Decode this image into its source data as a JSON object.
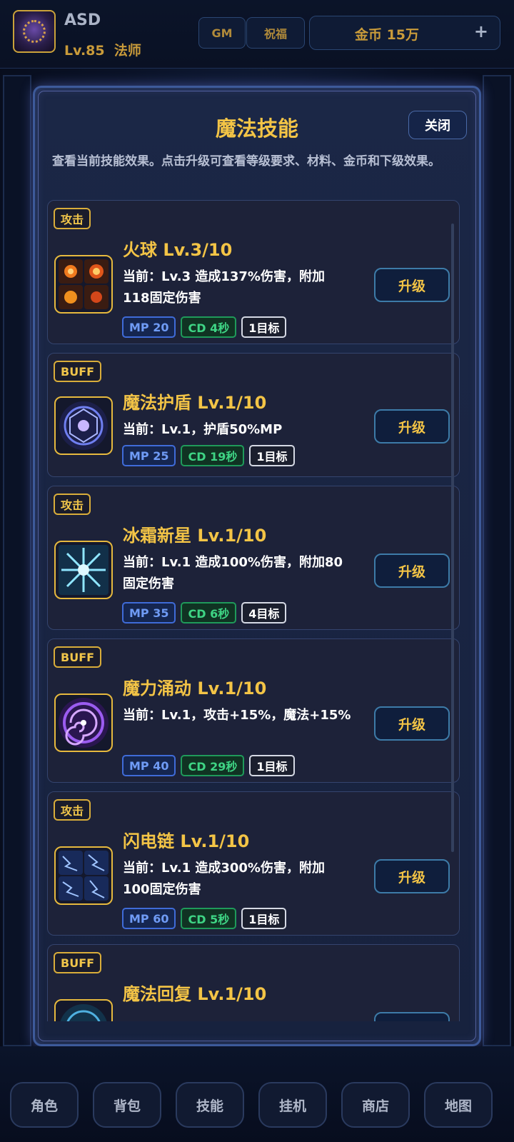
{
  "player": {
    "name": "ASD",
    "level": "Lv.85",
    "class": "法师"
  },
  "top_buttons": {
    "gm": "GM",
    "bless": "祝福",
    "gold": "金币 15万",
    "plus": "+"
  },
  "modal": {
    "title": "魔法技能",
    "close": "关闭",
    "description": "查看当前技能效果。点击升级可查看等级要求、材料、金币和下级效果。",
    "upgrade_label": "升级"
  },
  "skills": [
    {
      "tag": "攻击",
      "name": "火球  Lv.3/10",
      "desc": "当前：Lv.3 造成137%伤害，附加118固定伤害",
      "mp": "MP 20",
      "cd": "CD 4秒",
      "target": "1目标",
      "icon": "fireball-icon"
    },
    {
      "tag": "BUFF",
      "name": "魔法护盾  Lv.1/10",
      "desc": "当前：Lv.1，护盾50%MP",
      "mp": "MP 25",
      "cd": "CD 19秒",
      "target": "1目标",
      "icon": "magic-shield-icon"
    },
    {
      "tag": "攻击",
      "name": "冰霜新星  Lv.1/10",
      "desc": "当前：Lv.1 造成100%伤害，附加80固定伤害",
      "mp": "MP 35",
      "cd": "CD 6秒",
      "target": "4目标",
      "icon": "frost-nova-icon"
    },
    {
      "tag": "BUFF",
      "name": "魔力涌动  Lv.1/10",
      "desc": "当前：Lv.1，攻击+15%，魔法+15%",
      "mp": "MP 40",
      "cd": "CD 29秒",
      "target": "1目标",
      "icon": "mana-surge-icon"
    },
    {
      "tag": "攻击",
      "name": "闪电链  Lv.1/10",
      "desc": "当前：Lv.1 造成300%伤害，附加100固定伤害",
      "mp": "MP 60",
      "cd": "CD 5秒",
      "target": "1目标",
      "icon": "chain-lightning-icon"
    },
    {
      "tag": "BUFF",
      "name": "魔法回复  Lv.1/10",
      "desc": "",
      "mp": "",
      "cd": "",
      "target": "",
      "icon": "magic-recovery-icon"
    }
  ],
  "bottom_nav": [
    "角色",
    "背包",
    "技能",
    "挂机",
    "商店",
    "地图"
  ]
}
